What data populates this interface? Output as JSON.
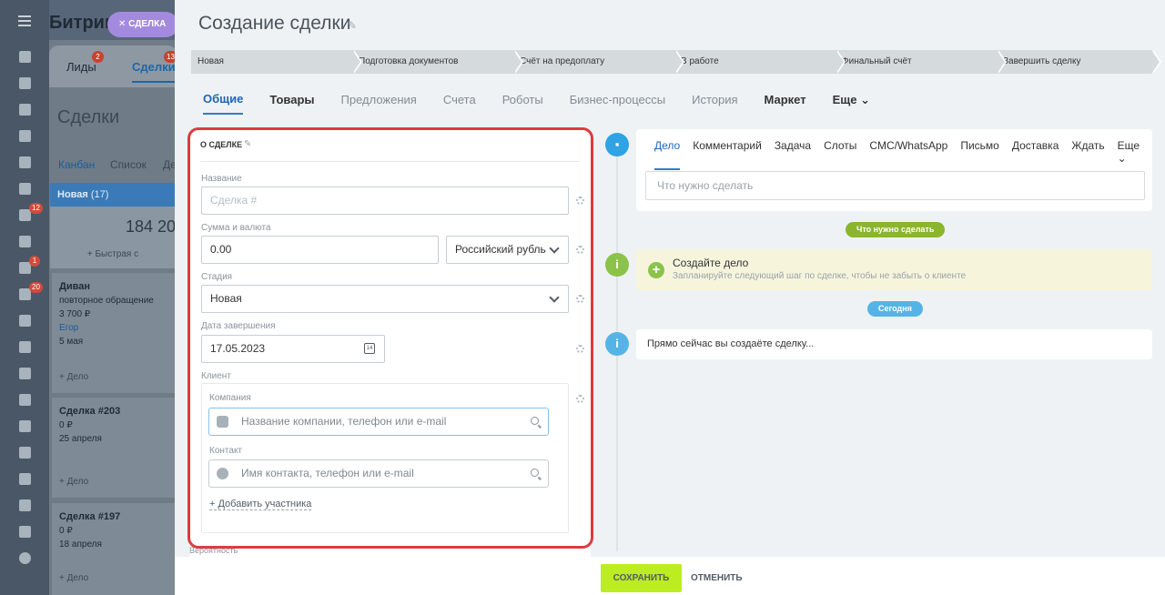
{
  "background": {
    "brand": "Битрик",
    "brand_tab_label": "СДЕЛКА",
    "rail_badges": [
      "12",
      "1",
      "20"
    ],
    "tabs": [
      {
        "label": "Лиды",
        "badge": "2"
      },
      {
        "label": "Сделки",
        "badge": "13"
      }
    ],
    "page_title": "Сделки",
    "views": [
      "Канбан",
      "Список",
      "Де"
    ],
    "column": {
      "name": "Новая",
      "count": "(17)",
      "sum": "184 20",
      "quick_add": "+ Быстрая с"
    },
    "cards": [
      {
        "title": "Диван",
        "subtitle": "повторное обращение",
        "amount": "3 700 ₽",
        "contact": "Егор",
        "date": "5 мая",
        "action": "+ Дело"
      },
      {
        "title": "Сделка #203",
        "amount": "0 ₽",
        "date": "25 апреля",
        "action": "+ Дело"
      },
      {
        "title": "Сделка #197",
        "amount": "0 ₽",
        "date": "18 апреля",
        "action": "+ Дело"
      }
    ]
  },
  "slider": {
    "title": "Создание сделки",
    "stages": [
      "Новая",
      "Подготовка документов",
      "Счёт на предоплату",
      "В работе",
      "Финальный счёт",
      "Завершить сделку"
    ],
    "tabs": [
      {
        "label": "Общие",
        "state": "active"
      },
      {
        "label": "Товары",
        "state": "dark"
      },
      {
        "label": "Предложения",
        "state": "normal"
      },
      {
        "label": "Счета",
        "state": "normal"
      },
      {
        "label": "Роботы",
        "state": "normal"
      },
      {
        "label": "Бизнес-процессы",
        "state": "normal"
      },
      {
        "label": "История",
        "state": "normal"
      },
      {
        "label": "Маркет",
        "state": "dark"
      }
    ],
    "tabs_more": "Еще"
  },
  "form": {
    "section_title": "О СДЕЛКЕ",
    "name": {
      "label": "Название",
      "placeholder": "Сделка #"
    },
    "amount": {
      "label": "Сумма и валюта",
      "value": "0.00",
      "currency": "Российский рубль"
    },
    "stage": {
      "label": "Стадия",
      "value": "Новая"
    },
    "close_date": {
      "label": "Дата завершения",
      "value": "17.05.2023",
      "cal_day": "14"
    },
    "client": {
      "label": "Клиент",
      "company_label": "Компания",
      "company_placeholder": "Название компании, телефон или e-mail",
      "contact_label": "Контакт",
      "contact_placeholder": "Имя контакта, телефон или e-mail",
      "add_participant": "+ Добавить участника"
    },
    "next_field_label": "Вероятность"
  },
  "timeline": {
    "composer_tabs": [
      "Дело",
      "Комментарий",
      "Задача",
      "Слоты",
      "СМС/WhatsApp",
      "Письмо",
      "Доставка",
      "Ждать"
    ],
    "composer_more": "Еще",
    "composer_placeholder": "Что нужно сделать",
    "todo_pill": "Что нужно сделать",
    "todo_title": "Создайте дело",
    "todo_subtitle": "Запланируйте следующий шаг по сделке, чтобы не забыть о клиенте",
    "today_pill": "Сегодня",
    "now_text": "Прямо сейчас вы создаёте сделку..."
  },
  "footer": {
    "save": "СОХРАНИТЬ",
    "cancel": "ОТМЕНИТЬ"
  },
  "colors": {
    "accent_blue": "#2f7ccc",
    "save_green": "#bbed21",
    "highlight_red": "#de3a3f",
    "todo_green": "#8bc34a"
  }
}
